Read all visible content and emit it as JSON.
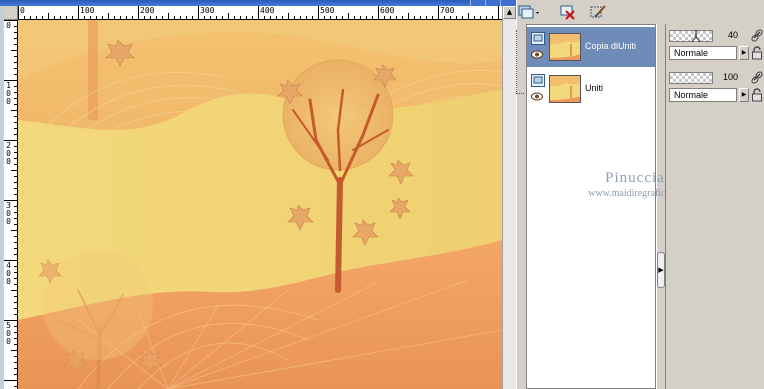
{
  "ruler": {
    "top_labels": [
      "0",
      "100",
      "200",
      "300",
      "400",
      "500",
      "600",
      "700"
    ],
    "left_labels": [
      "0",
      "100",
      "200",
      "300",
      "400",
      "500"
    ]
  },
  "toolbar": {
    "new_layer_icon": "new-raster-layer-icon",
    "delete_layer_icon": "delete-layer-icon",
    "edit_icon": "paintbrush-icon"
  },
  "layers": [
    {
      "name": "Copia diUniti",
      "selected": true,
      "visible": true,
      "opacity": "40",
      "blend_mode": "Normale"
    },
    {
      "name": "Uniti",
      "selected": false,
      "visible": true,
      "opacity": "100",
      "blend_mode": "Normale"
    }
  ],
  "watermark": {
    "title": "Pinuccia",
    "subtitle": "www.maidiregrafica.eu"
  },
  "colors": {
    "selection": "#6f8bb8",
    "panel_bg": "#d4d0c8",
    "canvas_sky": "#f2b66a",
    "canvas_yellow": "#f1d477",
    "canvas_orange": "#ed9a5a"
  }
}
